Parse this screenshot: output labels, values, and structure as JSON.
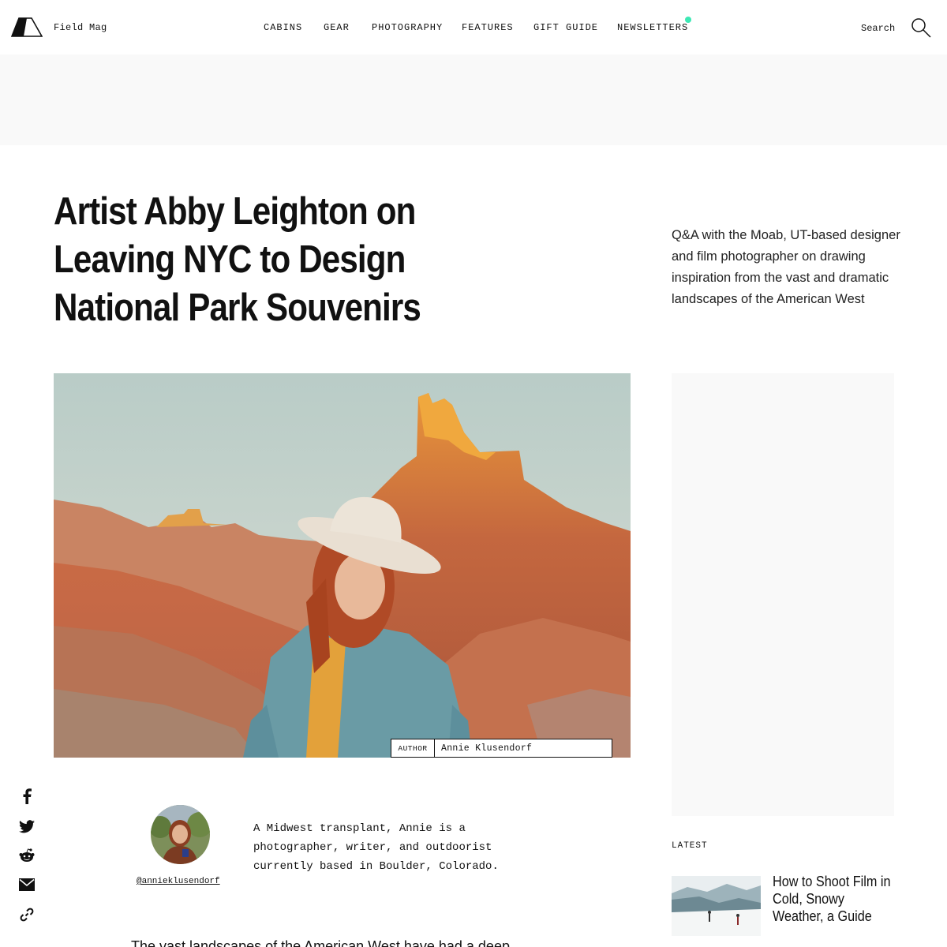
{
  "header": {
    "brand": "Field Mag",
    "nav": [
      "CABINS",
      "GEAR",
      "PHOTOGRAPHY",
      "FEATURES",
      "GIFT GUIDE",
      "NEWSLETTERS"
    ],
    "search_label": "Search",
    "accent_color": "#3ce8b4"
  },
  "article": {
    "title": "Artist Abby Leighton on Leaving NYC to Design National Park Souvenirs",
    "dek": "Q&A with the Moab, UT-based designer and film photographer on drawing inspiration from the vast and dramatic landscapes of the American West",
    "author_key": "AUTHOR",
    "author_name": "Annie Klusendorf",
    "body_start": "The vast landscapes of the American West have had a deep"
  },
  "author_bio": {
    "handle": "@annieklusendorf",
    "bio": "A Midwest transplant, Annie is a photographer, writer, and outdoorist currently based in Boulder, Colorado."
  },
  "share": [
    "facebook-icon",
    "twitter-icon",
    "reddit-icon",
    "email-icon",
    "link-icon"
  ],
  "latest": {
    "label": "LATEST",
    "items": [
      {
        "title": "How to Shoot Film in Cold, Snowy Weather, a Guide"
      }
    ]
  }
}
